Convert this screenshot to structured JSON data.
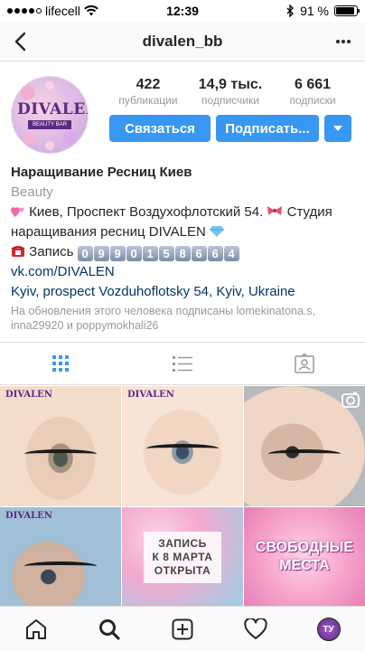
{
  "status_bar": {
    "carrier": "lifecell",
    "time": "12:39",
    "battery": "91 %",
    "signal_bars": 4,
    "signal_total": 5,
    "battery_level": 0.91
  },
  "nav": {
    "title": "divalen_bb",
    "back_icon": "chevron-left-icon",
    "more_icon": "more-horizontal-icon"
  },
  "profile": {
    "avatar_logo": "DIVALEN",
    "avatar_subtitle": "BEAUTY BAR",
    "stats": [
      {
        "value": "422",
        "label": "публикации"
      },
      {
        "value": "14,9 тыс.",
        "label": "подписчики"
      },
      {
        "value": "6 661",
        "label": "подписки"
      }
    ],
    "buttons": {
      "contact": "Связаться",
      "subscribe": "Подписать...",
      "dropdown_icon": "caret-down-icon"
    }
  },
  "bio": {
    "name": "Наращивание Ресниц Киев",
    "category": "Beauty",
    "line1_text": "Киев, Проспект Воздухофлотский 54.",
    "line1_suffix": "Студия наращивания ресниц DIVALEN",
    "line2_label": "Запись",
    "phone_digits": [
      "0",
      "9",
      "9",
      "0",
      "1",
      "5",
      "8",
      "6",
      "6",
      "4"
    ],
    "link": "vk.com/DIVALEN",
    "location": {
      "street": "Kyiv, prospect Vozduhoflotsky 54",
      "city": "Kyiv",
      "country": "Ukraine"
    },
    "mutual": "На обновления этого человека подписаны lomekinatona.s, inna29920 и poppymokhali26"
  },
  "tabs": [
    {
      "name": "grid-icon",
      "active": true
    },
    {
      "name": "list-icon",
      "active": false
    },
    {
      "name": "tagged-icon",
      "active": false
    }
  ],
  "grid": {
    "posts": [
      {
        "type": "photo",
        "overlay": "DIVALEN"
      },
      {
        "type": "photo",
        "overlay": "DIVALEN"
      },
      {
        "type": "video"
      },
      {
        "type": "photo",
        "overlay": "DIVALEN"
      },
      {
        "type": "promo",
        "lines": [
          "ЗАПИСЬ",
          "К 8 МАРТА",
          "ОТКРЫТА"
        ]
      },
      {
        "type": "promo",
        "lines": [
          "СВОБОДНЫЕ",
          "МЕСТА"
        ]
      }
    ]
  },
  "bottom_nav": [
    {
      "name": "home-icon"
    },
    {
      "name": "search-icon"
    },
    {
      "name": "add-post-icon"
    },
    {
      "name": "heart-icon"
    },
    {
      "name": "profile-avatar",
      "label": "ТУ"
    }
  ],
  "colors": {
    "accent": "#3897f0",
    "link": "#003569",
    "muted": "#999999",
    "brand_purple": "#5a2b82"
  }
}
